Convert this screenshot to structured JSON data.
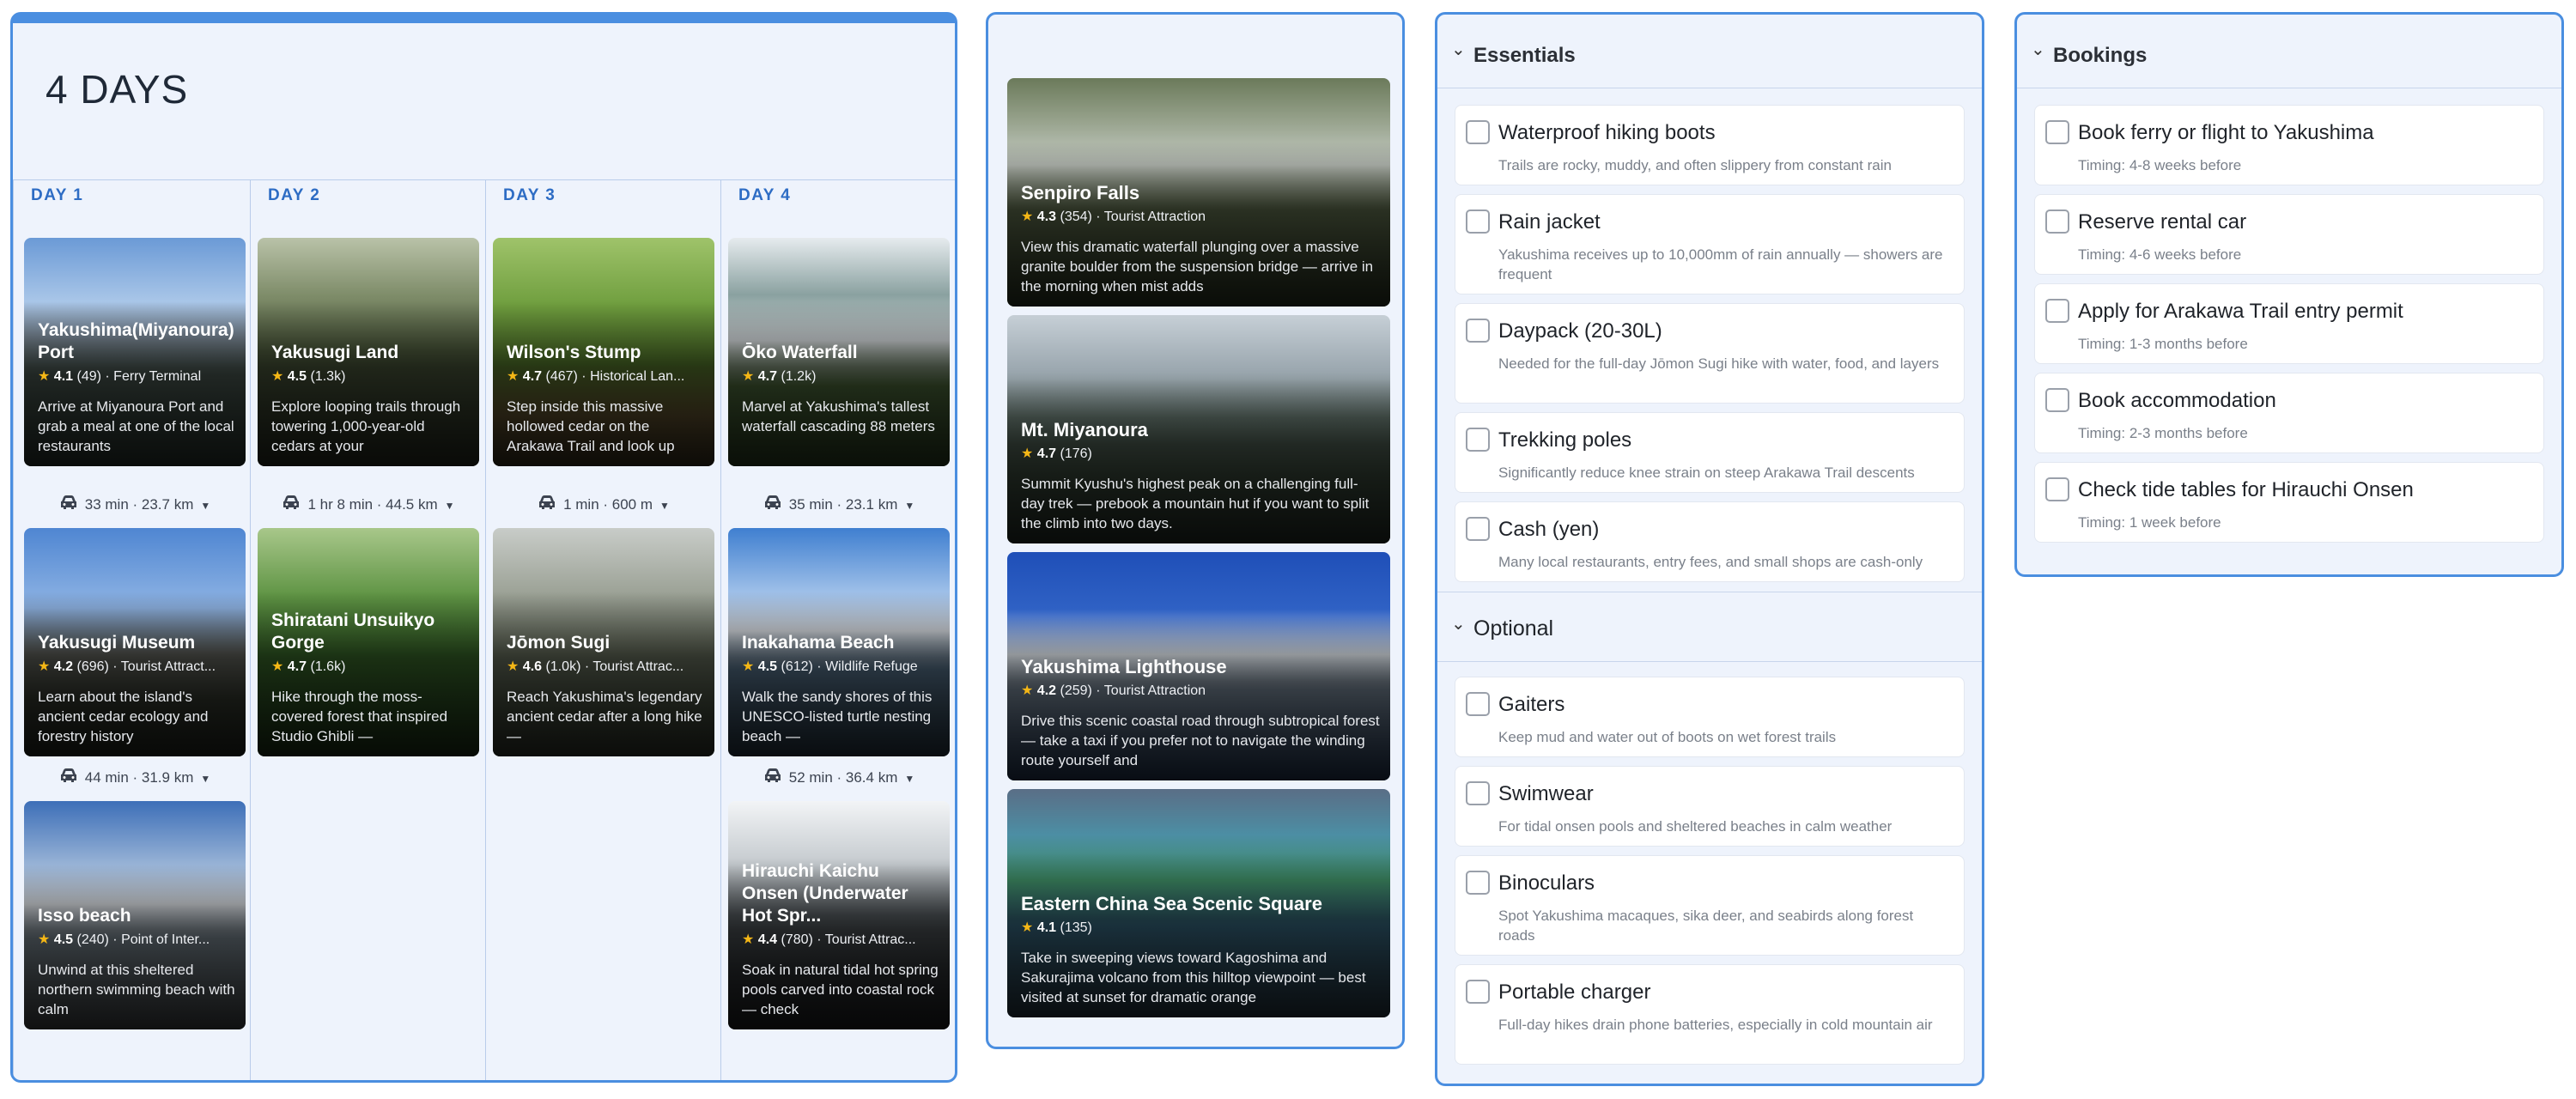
{
  "itinerary": {
    "title": "4 DAYS",
    "days": [
      {
        "label": "DAY 1",
        "cards": [
          {
            "name": "Yakushima(Miyanoura) Port",
            "rating": "4.1",
            "reviews": "(49)",
            "category": "Ferry Terminal",
            "desc": "Arrive at Miyanoura Port and grab a meal at one of the local restaurants"
          },
          {
            "name": "Yakusugi Museum",
            "rating": "4.2",
            "reviews": "(696)",
            "category": "Tourist Attract...",
            "desc": "Learn about the island's ancient cedar ecology and forestry history"
          },
          {
            "name": "Isso beach",
            "rating": "4.5",
            "reviews": "(240)",
            "category": "Point of Inter...",
            "desc": "Unwind at this sheltered northern swimming beach with calm"
          }
        ],
        "travel": [
          "33 min · 23.7 km",
          "44 min · 31.9 km"
        ]
      },
      {
        "label": "DAY 2",
        "cards": [
          {
            "name": "Yakusugi Land",
            "rating": "4.5",
            "reviews": "(1.3k)",
            "category": "",
            "desc": "Explore looping trails through towering 1,000-year-old cedars at your"
          },
          {
            "name": "Shiratani Unsuikyo Gorge",
            "rating": "4.7",
            "reviews": "(1.6k)",
            "category": "",
            "desc": "Hike through the moss-covered forest that inspired Studio Ghibli —"
          }
        ],
        "travel": [
          "1 hr 8 min · 44.5 km"
        ]
      },
      {
        "label": "DAY 3",
        "cards": [
          {
            "name": "Wilson's Stump",
            "rating": "4.7",
            "reviews": "(467)",
            "category": "Historical Lan...",
            "desc": "Step inside this massive hollowed cedar on the Arakawa Trail and look up"
          },
          {
            "name": "Jōmon Sugi",
            "rating": "4.6",
            "reviews": "(1.0k)",
            "category": "Tourist Attrac...",
            "desc": "Reach Yakushima's legendary ancient cedar after a long hike —"
          }
        ],
        "travel": [
          "1 min · 600 m"
        ]
      },
      {
        "label": "DAY 4",
        "cards": [
          {
            "name": "Ōko Waterfall",
            "rating": "4.7",
            "reviews": "(1.2k)",
            "category": "",
            "desc": "Marvel at Yakushima's tallest waterfall cascading 88 meters"
          },
          {
            "name": "Inakahama Beach",
            "rating": "4.5",
            "reviews": "(612)",
            "category": "Wildlife Refuge",
            "desc": "Walk the sandy shores of this UNESCO-listed turtle nesting beach —"
          },
          {
            "name": "Hirauchi Kaichu Onsen (Underwater Hot Spr...",
            "rating": "4.4",
            "reviews": "(780)",
            "category": "Tourist Attrac...",
            "desc": "Soak in natural tidal hot spring pools carved into coastal rock — check"
          }
        ],
        "travel": [
          "35 min · 23.1 km",
          "52 min · 36.4 km"
        ]
      }
    ]
  },
  "places": [
    {
      "name": "Senpiro Falls",
      "rating": "4.3",
      "reviews": "(354)",
      "category": "Tourist Attraction",
      "desc": "View this dramatic waterfall plunging over a massive granite boulder from the suspension bridge — arrive in the morning when mist adds"
    },
    {
      "name": "Mt. Miyanoura",
      "rating": "4.7",
      "reviews": "(176)",
      "category": "",
      "desc": "Summit Kyushu's highest peak on a challenging full-day trek — prebook a mountain hut if you want to split the climb into two days."
    },
    {
      "name": "Yakushima Lighthouse",
      "rating": "4.2",
      "reviews": "(259)",
      "category": "Tourist Attraction",
      "desc": "Drive this scenic coastal road through subtropical forest — take a taxi if you prefer not to navigate the winding route yourself and"
    },
    {
      "name": "Eastern China Sea Scenic Square",
      "rating": "4.1",
      "reviews": "(135)",
      "category": "",
      "desc": "Take in sweeping views toward Kagoshima and Sakurajima volcano from this hilltop viewpoint — best visited at sunset for dramatic orange"
    }
  ],
  "essentials": {
    "title": "Essentials",
    "items": [
      {
        "label": "Waterproof hiking boots",
        "note": "Trails are rocky, muddy, and often slippery from constant rain"
      },
      {
        "label": "Rain jacket",
        "note": "Yakushima receives up to 10,000mm of rain annually — showers are frequent"
      },
      {
        "label": "Daypack (20-30L)",
        "note": "Needed for the full-day Jōmon Sugi hike with water, food, and layers"
      },
      {
        "label": "Trekking poles",
        "note": "Significantly reduce knee strain on steep Arakawa Trail descents"
      },
      {
        "label": "Cash (yen)",
        "note": "Many local restaurants, entry fees, and small shops are cash-only"
      }
    ],
    "optional_title": "Optional",
    "optional_items": [
      {
        "label": "Gaiters",
        "note": "Keep mud and water out of boots on wet forest trails"
      },
      {
        "label": "Swimwear",
        "note": "For tidal onsen pools and sheltered beaches in calm weather"
      },
      {
        "label": "Binoculars",
        "note": "Spot Yakushima macaques, sika deer, and seabirds along forest roads"
      },
      {
        "label": "Portable charger",
        "note": "Full-day hikes drain phone batteries, especially in cold mountain air"
      }
    ]
  },
  "bookings": {
    "title": "Bookings",
    "items": [
      {
        "label": "Book ferry or flight to Yakushima",
        "note": "Timing: 4-8 weeks before"
      },
      {
        "label": "Reserve rental car",
        "note": "Timing: 4-6 weeks before"
      },
      {
        "label": "Apply for Arakawa Trail entry permit",
        "note": "Timing: 1-3 months before"
      },
      {
        "label": "Book accommodation",
        "note": "Timing: 2-3 months before"
      },
      {
        "label": "Check tide tables for Hirauchi Onsen",
        "note": "Timing: 1 week before"
      }
    ]
  },
  "icons": {
    "collapse": "chevron-down-icon",
    "star": "star-icon",
    "car": "car-icon",
    "dropdown": "caret-down-icon"
  },
  "colors": {
    "accent": "#4a8ee0",
    "day_label": "#2d6cc4",
    "star": "#f5b716",
    "panel_bg": "#eef3fc"
  }
}
